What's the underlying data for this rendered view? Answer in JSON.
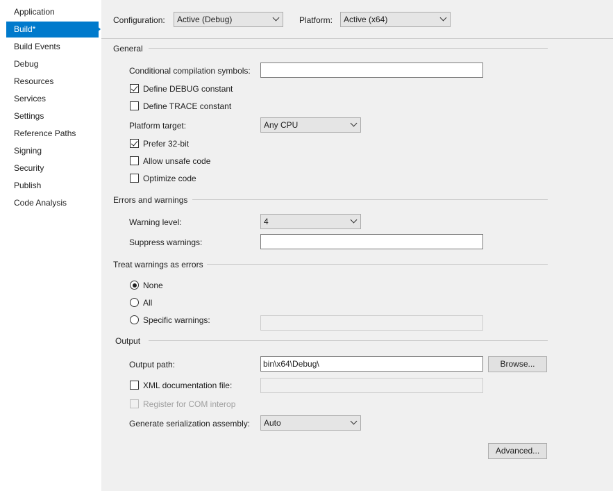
{
  "sidebar": {
    "items": [
      {
        "label": "Application"
      },
      {
        "label": "Build*"
      },
      {
        "label": "Build Events"
      },
      {
        "label": "Debug"
      },
      {
        "label": "Resources"
      },
      {
        "label": "Services"
      },
      {
        "label": "Settings"
      },
      {
        "label": "Reference Paths"
      },
      {
        "label": "Signing"
      },
      {
        "label": "Security"
      },
      {
        "label": "Publish"
      },
      {
        "label": "Code Analysis"
      }
    ],
    "active_index": 1,
    "accent_color": "#007acc"
  },
  "toolbar": {
    "configuration_label": "Configuration:",
    "configuration_value": "Active (Debug)",
    "platform_label": "Platform:",
    "platform_value": "Active (x64)"
  },
  "general": {
    "header": "General",
    "conditional_symbols_label": "Conditional compilation symbols:",
    "conditional_symbols_value": "",
    "define_debug_label": "Define DEBUG constant",
    "define_debug_checked": true,
    "define_trace_label": "Define TRACE constant",
    "define_trace_checked": false,
    "platform_target_label": "Platform target:",
    "platform_target_value": "Any CPU",
    "prefer32_label": "Prefer 32-bit",
    "prefer32_checked": true,
    "unsafe_label": "Allow unsafe code",
    "unsafe_checked": false,
    "optimize_label": "Optimize code",
    "optimize_checked": false
  },
  "errors": {
    "header": "Errors and warnings",
    "warning_level_label": "Warning level:",
    "warning_level_value": "4",
    "suppress_label": "Suppress warnings:",
    "suppress_value": ""
  },
  "treat": {
    "header": "Treat warnings as errors",
    "none_label": "None",
    "all_label": "All",
    "specific_label": "Specific warnings:",
    "specific_value": "",
    "selected": "none"
  },
  "output": {
    "header": "Output",
    "path_label": "Output path:",
    "path_value": "bin\\x64\\Debug\\",
    "browse_label": "Browse...",
    "xml_label": "XML documentation file:",
    "xml_checked": false,
    "xml_value": "",
    "com_label": "Register for COM interop",
    "com_checked": false,
    "serialization_label": "Generate serialization assembly:",
    "serialization_value": "Auto",
    "advanced_label": "Advanced..."
  }
}
